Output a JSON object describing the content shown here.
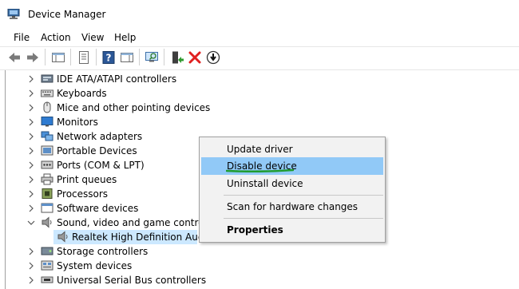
{
  "window": {
    "title": "Device Manager"
  },
  "menu": [
    "File",
    "Action",
    "View",
    "Help"
  ],
  "toolbar": {
    "buttons": [
      "back-icon",
      "forward-icon",
      "show-hide-console-tree-icon",
      "properties-icon",
      "help-icon",
      "action-pane-icon",
      "scan-hardware-icon",
      "update-driver-icon",
      "uninstall-icon",
      "disable-device-icon"
    ]
  },
  "tree": {
    "items": [
      {
        "label": "IDE ATA/ATAPI controllers",
        "icon": "ide-controller-icon",
        "expanded": false
      },
      {
        "label": "Keyboards",
        "icon": "keyboard-icon",
        "expanded": false
      },
      {
        "label": "Mice and other pointing devices",
        "icon": "mouse-icon",
        "expanded": false
      },
      {
        "label": "Monitors",
        "icon": "monitor-icon",
        "expanded": false
      },
      {
        "label": "Network adapters",
        "icon": "network-adapter-icon",
        "expanded": false
      },
      {
        "label": "Portable Devices",
        "icon": "portable-device-icon",
        "expanded": false
      },
      {
        "label": "Ports (COM & LPT)",
        "icon": "port-icon",
        "expanded": false
      },
      {
        "label": "Print queues",
        "icon": "printer-icon",
        "expanded": false
      },
      {
        "label": "Processors",
        "icon": "processor-icon",
        "expanded": false
      },
      {
        "label": "Software devices",
        "icon": "software-device-icon",
        "expanded": false
      },
      {
        "label": "Sound, video and game controllers",
        "icon": "speaker-icon",
        "expanded": true
      },
      {
        "label": "Storage controllers",
        "icon": "storage-controller-icon",
        "expanded": false
      },
      {
        "label": "System devices",
        "icon": "system-device-icon",
        "expanded": false
      },
      {
        "label": "Universal Serial Bus controllers",
        "icon": "usb-controller-icon",
        "expanded": false
      }
    ],
    "child": {
      "label": "Realtek High Definition Audio",
      "icon": "speaker-icon",
      "selected": true
    }
  },
  "context_menu": {
    "items": [
      "Update driver",
      "Disable device",
      "Uninstall device",
      "Scan for hardware changes",
      "Properties"
    ],
    "highlighted": "Disable device"
  },
  "colors": {
    "selection": "#cce8ff",
    "menu_highlight": "#91c9f7",
    "underline": "#1f9b2e",
    "delete_red": "#e02020"
  }
}
